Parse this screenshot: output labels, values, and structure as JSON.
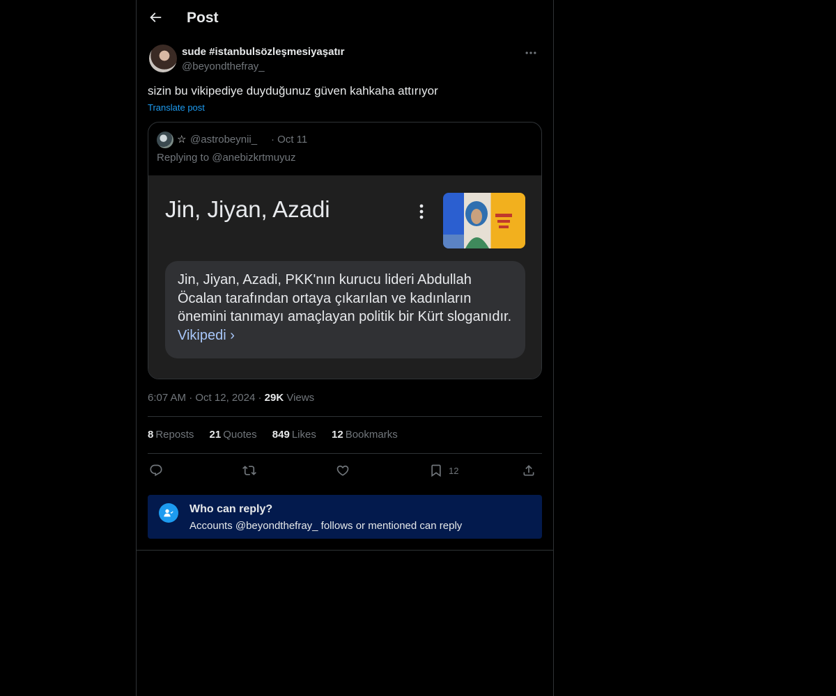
{
  "header": {
    "title": "Post"
  },
  "post": {
    "author_name": "sude #istanbulsözleşmesiyaşatır",
    "author_handle": "@beyondthefray_",
    "text": "sizin bu vikipediye duyduğunuz güven kahkaha attırıyor",
    "translate_label": "Translate post",
    "time": "6:07 AM",
    "date": "Oct 12, 2024",
    "views_count": "29K",
    "views_label": "Views"
  },
  "quote": {
    "star": "☆",
    "handle": "@astrobeynii_",
    "date": "Oct 11",
    "replying_to": "Replying to @anebizkrtmuyuz",
    "image": {
      "title": "Jin, Jiyan, Azadi",
      "card_text": "Jin, Jiyan, Azadi, PKK'nın kurucu lideri Abdullah Öcalan tarafından ortaya çıkarılan ve kadınların önemini tanımayı amaçlayan politik bir Kürt sloganıdır.",
      "card_link": "Vikipedi ›"
    }
  },
  "stats": {
    "reposts": {
      "count": "8",
      "label": "Reposts"
    },
    "quotes": {
      "count": "21",
      "label": "Quotes"
    },
    "likes": {
      "count": "849",
      "label": "Likes"
    },
    "bookmarks": {
      "count": "12",
      "label": "Bookmarks"
    }
  },
  "actions": {
    "bookmark_count": "12"
  },
  "who_can_reply": {
    "title": "Who can reply?",
    "subtitle": "Accounts @beyondthefray_ follows or mentioned can reply"
  },
  "colors": {
    "accent": "#1d9bf0",
    "background": "#000000",
    "muted": "#71767b",
    "banner": "#031a4d"
  }
}
